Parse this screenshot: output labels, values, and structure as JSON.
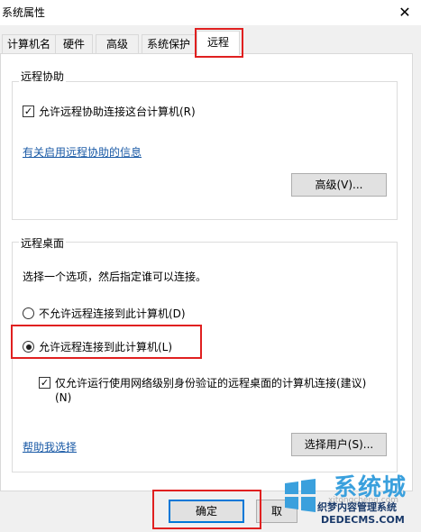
{
  "window": {
    "title": "系统属性",
    "close_glyph": "✕"
  },
  "tabs": [
    {
      "label": "计算机名"
    },
    {
      "label": "硬件"
    },
    {
      "label": "高级"
    },
    {
      "label": "系统保护"
    },
    {
      "label": "远程",
      "active": true
    }
  ],
  "remote_assistance": {
    "group_label": "远程协助",
    "allow_checkbox_label": "允许远程协助连接这台计算机(R)",
    "allow_checked": true,
    "info_link": "有关启用远程协助的信息",
    "advanced_button": "高级(V)..."
  },
  "remote_desktop": {
    "group_label": "远程桌面",
    "instruction": "选择一个选项，然后指定谁可以连接。",
    "option_deny": "不允许远程连接到此计算机(D)",
    "option_allow": "允许远程连接到此计算机(L)",
    "selected": "allow",
    "nla_checkbox_line1": "仅允许运行使用网络级别身份验证的远程桌面的计算机连接(建议)",
    "nla_checkbox_line2": "(N)",
    "nla_checked": true,
    "help_link": "帮助我选择",
    "select_users_button": "选择用户(S)..."
  },
  "footer": {
    "ok_button": "确定",
    "cancel_button_partial": "取"
  },
  "watermark": {
    "brand_big": "系统城",
    "brand_sub": "xitongcheng.com",
    "site_name": "织梦内容管理系统",
    "site_url": "DEDECMS.COM"
  },
  "colors": {
    "highlight": "#e02020",
    "link": "#1a5aa6",
    "accent": "#0078d7"
  }
}
